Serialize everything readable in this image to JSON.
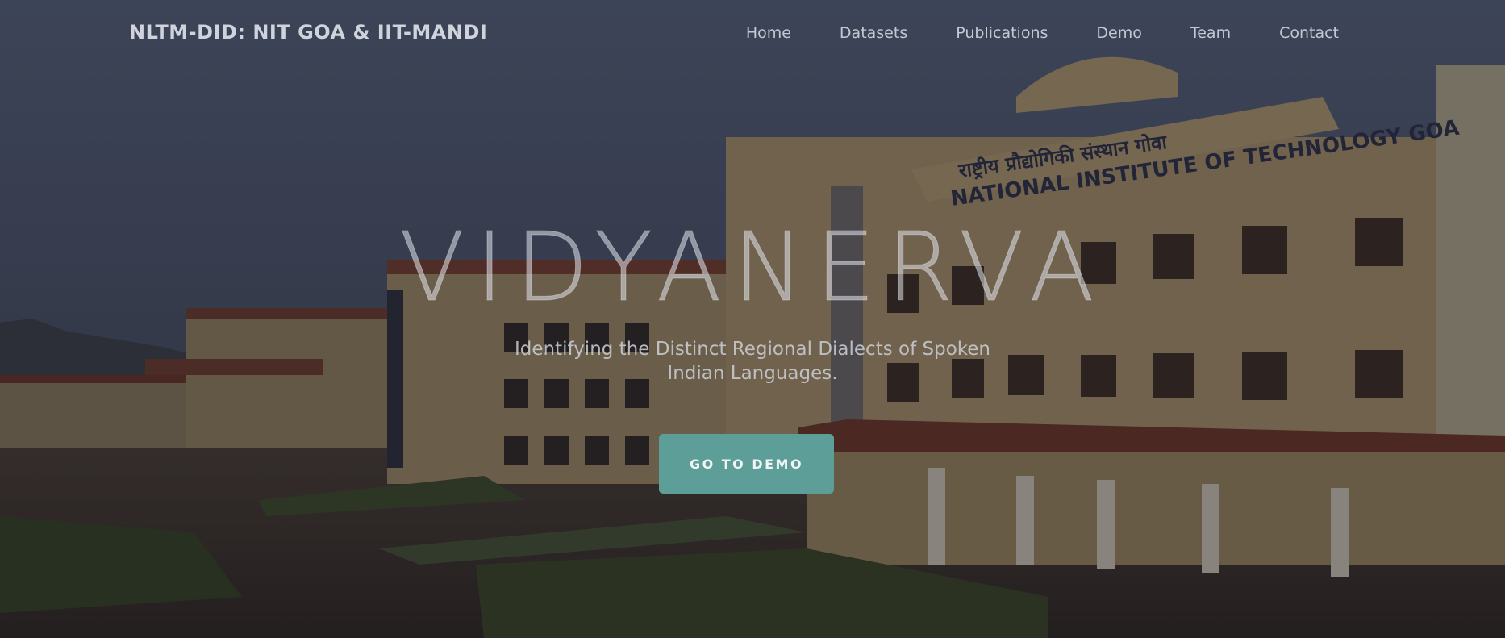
{
  "nav": {
    "brand": "NLTM-DID: NIT GOA & IIT-MANDI",
    "links": [
      {
        "label": "Home"
      },
      {
        "label": "Datasets"
      },
      {
        "label": "Publications"
      },
      {
        "label": "Demo"
      },
      {
        "label": "Team"
      },
      {
        "label": "Contact"
      }
    ]
  },
  "hero": {
    "title": "VIDYANERVA",
    "subtitle": "Identifying the Distinct Regional Dialects of Spoken Indian Languages.",
    "cta_label": "GO TO DEMO",
    "building_sign_english": "NATIONAL INSTITUTE OF TECHNOLOGY GOA",
    "building_sign_hindi": "राष्ट्रीय प्रौद्योगिकी संस्थान गोवा"
  },
  "colors": {
    "cta_background": "#5e9e98",
    "sky": "#4a5670",
    "building": "#b8a070",
    "roof": "#7a3a2a"
  }
}
